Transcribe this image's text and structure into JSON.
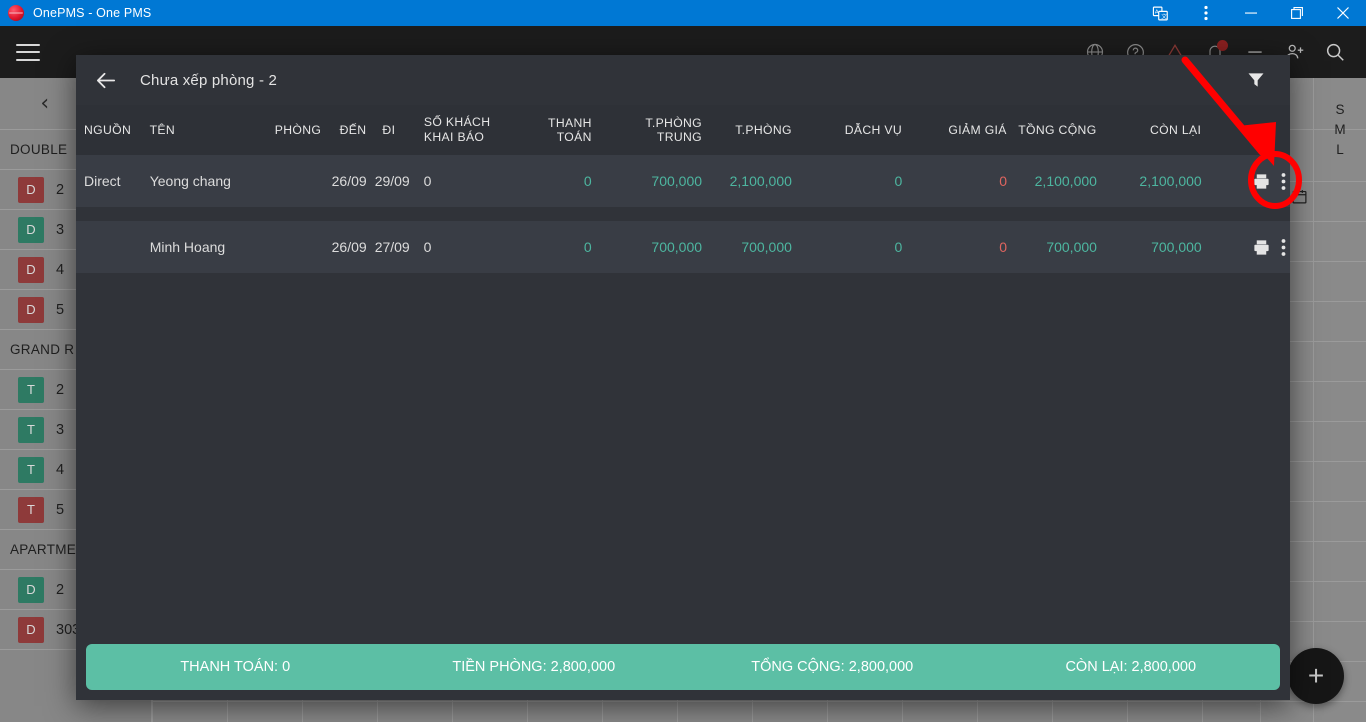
{
  "window": {
    "title": "OnePMS - One PMS",
    "controls": {
      "translate": "translate-icon",
      "more": "more-vertical-icon",
      "minimize": "–",
      "maximize": "maximize-icon",
      "close": "close-icon"
    }
  },
  "app": {
    "menu_icon": "hamburger-icon",
    "top_icons": [
      "globe-icon",
      "help-icon",
      "warning-icon",
      "notification-bell-icon",
      "minus-icon",
      "add-person-icon",
      "search-icon"
    ],
    "prev_label": "‹",
    "next_label": "›",
    "size_legend": [
      "S",
      "M",
      "L"
    ],
    "fab_label": "+",
    "groups": [
      {
        "name": "DOUBLE",
        "rooms": [
          {
            "badge": "D",
            "color": "red",
            "number": "2"
          },
          {
            "badge": "D",
            "color": "green",
            "number": "3"
          },
          {
            "badge": "D",
            "color": "red",
            "number": "4"
          },
          {
            "badge": "D",
            "color": "red",
            "number": "5"
          }
        ]
      },
      {
        "name": "GRAND R",
        "rooms": [
          {
            "badge": "T",
            "color": "green",
            "number": "2"
          },
          {
            "badge": "T",
            "color": "green",
            "number": "3"
          },
          {
            "badge": "T",
            "color": "green",
            "number": "4"
          },
          {
            "badge": "T",
            "color": "red",
            "number": "5"
          }
        ]
      },
      {
        "name": "APARTME",
        "rooms": [
          {
            "badge": "D",
            "color": "green",
            "number": "2"
          },
          {
            "badge": "D",
            "color": "red",
            "number": "303"
          }
        ]
      }
    ]
  },
  "dialog": {
    "back_icon": "back-arrow-icon",
    "title": "Chưa xếp phòng - 2",
    "filter_icon": "filter-icon",
    "columns": {
      "nguon": "NGUỒN",
      "ten": "TÊN",
      "phong": "PHÒNG",
      "den": "ĐẾN",
      "di": "ĐI",
      "so_khach_l1": "SỐ KHÁCH",
      "so_khach_l2": "KHAI BÁO",
      "thanh_toan": "THANH TOÁN",
      "tphong_trung": "T.PHÒNG TRUNG",
      "tphong": "T.PHÒNG",
      "dich_vu": "DẪCH VỤ",
      "giam_gia": "GIẢM GIÁ",
      "tong_cong": "TỒNG CỘNG",
      "con_lai": "CÒN LẠI"
    },
    "rows": [
      {
        "nguon": "Direct",
        "ten": "Yeong chang",
        "phong": "",
        "den": "26/09",
        "di": "29/09",
        "so_khach": "0",
        "thanh_toan": "0",
        "tphong_trung": "700,000",
        "tphong": "2,100,000",
        "dich_vu": "0",
        "giam_gia": "0",
        "tong_cong": "2,100,000",
        "con_lai": "2,100,000",
        "print_icon": "print-icon",
        "more_icon": "more-vertical-icon"
      },
      {
        "nguon": "",
        "ten": "Minh Hoang",
        "phong": "",
        "den": "26/09",
        "di": "27/09",
        "so_khach": "0",
        "thanh_toan": "0",
        "tphong_trung": "700,000",
        "tphong": "700,000",
        "dich_vu": "0",
        "giam_gia": "0",
        "tong_cong": "700,000",
        "con_lai": "700,000",
        "print_icon": "print-icon",
        "more_icon": "more-vertical-icon"
      }
    ],
    "footer": {
      "thanh_toan": "THANH TOÁN: 0",
      "tien_phong": "TIỀN PHÒNG: 2,800,000",
      "tong_cong": "TỔNG CỘNG: 2,800,000",
      "con_lai": "CÒN LẠI: 2,800,000"
    }
  },
  "colors": {
    "titlebar": "#0078d4",
    "dialog_bg": "#303339",
    "row_bg": "#393d45",
    "accent_teal": "#4db6a0",
    "footer_teal": "#5cbfa5",
    "negative_red": "#e0655f",
    "annotation_red": "#ff0000"
  },
  "annotation": {
    "type": "arrow-and-ellipse",
    "target": "row-1-more-menu"
  }
}
